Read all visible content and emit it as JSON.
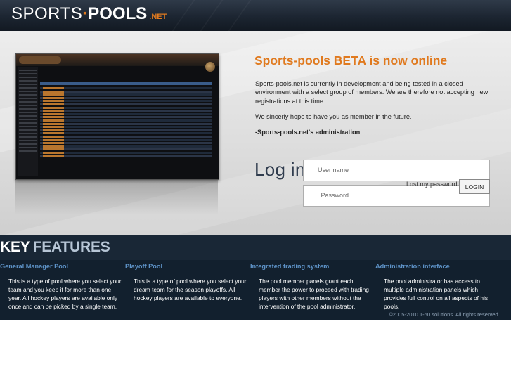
{
  "header": {
    "logo_part1": "SPORTS",
    "logo_dot": "·",
    "logo_part2": "POOLS",
    "logo_tld": ".NET"
  },
  "hero": {
    "headline": "Sports-pools BETA is now online",
    "intro": "Sports-pools.net is currently in development and being tested in a closed environment with a select group of members. We are therefore not accepting new registrations at this time.",
    "hope": "We sincerly hope to have you as member in the future.",
    "signature": "-Sports-pools.net's administration"
  },
  "login": {
    "title": "Log in",
    "username_label": "User name",
    "password_label": "Password",
    "lost_password": "Lost my password",
    "button": "LOGIN"
  },
  "features": {
    "title_key": "KEY",
    "title_rest": "FEATURES",
    "items": [
      {
        "title": "General Manager Pool",
        "text": "This is a type of pool where you select your team and you keep it for more than one year. All hockey players are available only once and can be picked by a single team."
      },
      {
        "title": "Playoff Pool",
        "text": "This is a type of pool where you select your dream team for the season playoffs. All hockey players are available to everyone."
      },
      {
        "title": "Integrated trading system",
        "text": "The pool member panels grant each member the power to proceed with trading players with other members without the intervention of the pool administrator."
      },
      {
        "title": "Administration interface",
        "text": "The pool administrator has access to multiple administration panels which provides full control on all aspects of his pools."
      }
    ],
    "copyright": "©2005-2010 T-60 solutions. All rights reserved."
  },
  "colors": {
    "accent": "#e07a1f",
    "header_bg": "#1c2531",
    "feature_title": "#5e93c8",
    "features_bg": "#162231"
  }
}
